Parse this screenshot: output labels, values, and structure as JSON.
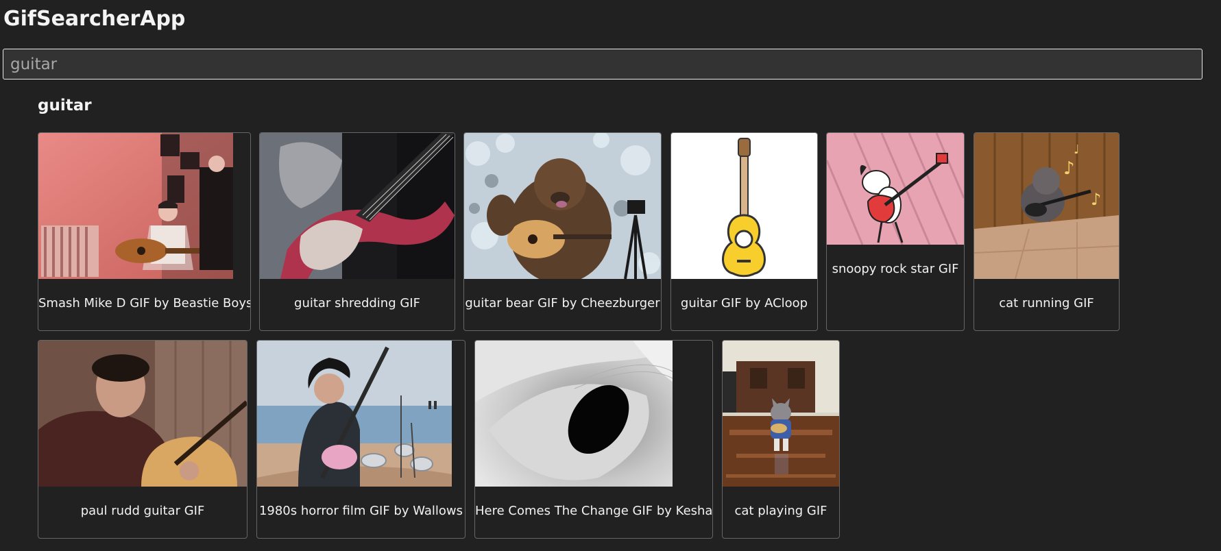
{
  "app": {
    "title": "GifSearcherApp"
  },
  "search": {
    "value": "guitar"
  },
  "results": {
    "category": "guitar",
    "cards": [
      {
        "title": "Smash Mike D GIF by Beastie Boys"
      },
      {
        "title": "guitar shredding GIF"
      },
      {
        "title": "guitar bear GIF by Cheezburger"
      },
      {
        "title": "guitar GIF by ACloop"
      },
      {
        "title": "snoopy rock star GIF"
      },
      {
        "title": "cat running GIF"
      },
      {
        "title": "paul rudd guitar GIF"
      },
      {
        "title": "1980s horror film GIF by Wallows"
      },
      {
        "title": "Here Comes The Change GIF by Kesha"
      },
      {
        "title": "cat playing GIF"
      }
    ]
  }
}
